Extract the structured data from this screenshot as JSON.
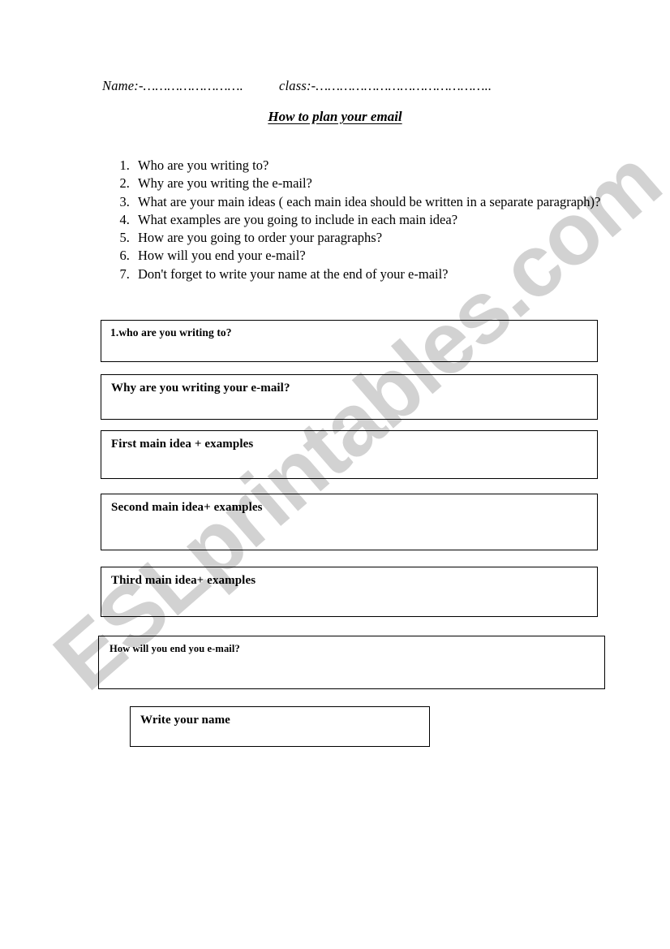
{
  "document": {
    "title": "How to plan your email",
    "header": {
      "name_field": "Name:-…………………….",
      "class_field": "class:-…………………………………….."
    }
  },
  "questions": [
    "Who are you writing to?",
    "Why are you writing the e-mail?",
    "What are your main ideas ( each main idea should be written in a separate  paragraph)?",
    "What examples are you going to include in each main idea?",
    "How are you going to order your paragraphs?",
    "How will you end your e-mail?",
    "Don't forget to write your name at the end of your e-mail?"
  ],
  "answer_boxes": [
    {
      "label": "1.who  are you writing  to?"
    },
    {
      "label": "Why are you writing your e-mail?"
    },
    {
      "label": "First main idea + examples"
    },
    {
      "label": "Second  main idea+ examples"
    },
    {
      "label": "Third main idea+ examples"
    },
    {
      "label": "How will you end you e-mail?"
    },
    {
      "label": "Write your name"
    }
  ],
  "watermark": {
    "text": "ESLprintables.com",
    "color": "#d2d2d2"
  },
  "colors": {
    "page_background": "#ffffff",
    "text": "#000000",
    "box_border": "#000000"
  }
}
